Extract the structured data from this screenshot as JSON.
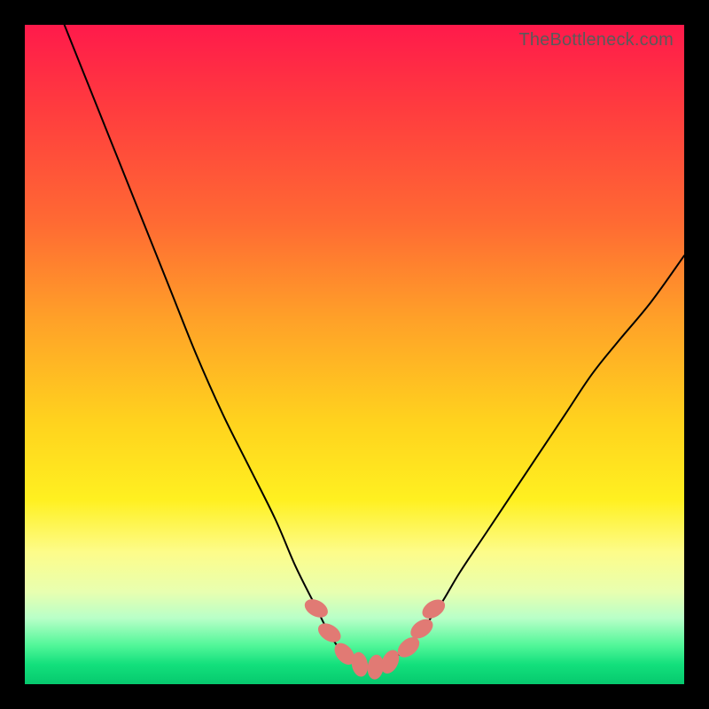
{
  "watermark": "TheBottleneck.com",
  "colors": {
    "frame": "#000000",
    "curve": "#000000",
    "bead": "#e17a74",
    "gradient_top": "#ff1a4b",
    "gradient_bottom": "#06c96e"
  },
  "chart_data": {
    "type": "line",
    "title": "",
    "xlabel": "",
    "ylabel": "",
    "xlim": [
      0,
      100
    ],
    "ylim": [
      0,
      100
    ],
    "axes_visible": false,
    "grid": false,
    "left_curve": {
      "name": "left",
      "x": [
        6,
        10,
        14,
        18,
        22,
        26,
        30,
        34,
        38,
        41,
        44,
        46,
        48,
        50,
        52
      ],
      "y": [
        100,
        90,
        80,
        70,
        60,
        50,
        41,
        33,
        25,
        18,
        12,
        8,
        5,
        3.2,
        2.6
      ]
    },
    "right_curve": {
      "name": "right",
      "x": [
        52,
        54,
        56,
        58,
        60,
        63,
        66,
        70,
        74,
        78,
        82,
        86,
        90,
        95,
        100
      ],
      "y": [
        2.6,
        3.0,
        4.0,
        5.5,
        8,
        12,
        17,
        23,
        29,
        35,
        41,
        47,
        52,
        58,
        65
      ]
    },
    "minimum": {
      "x": 52,
      "y": 2.6
    },
    "beads": [
      {
        "x": 44.2,
        "y": 11.5,
        "rot": -62
      },
      {
        "x": 46.2,
        "y": 7.8,
        "rot": -58
      },
      {
        "x": 48.5,
        "y": 4.6,
        "rot": -40
      },
      {
        "x": 50.8,
        "y": 3.0,
        "rot": -10
      },
      {
        "x": 53.2,
        "y": 2.6,
        "rot": 8
      },
      {
        "x": 55.4,
        "y": 3.4,
        "rot": 25
      },
      {
        "x": 58.2,
        "y": 5.6,
        "rot": 50
      },
      {
        "x": 60.2,
        "y": 8.4,
        "rot": 55
      },
      {
        "x": 62.0,
        "y": 11.4,
        "rot": 58
      }
    ],
    "notes": "Two black curves on a vertical rainbow gradient; left branch descends steeply from top-left, right branch rises more gently toward mid-right; small salmon-colored capsule beads cluster along the trough."
  }
}
